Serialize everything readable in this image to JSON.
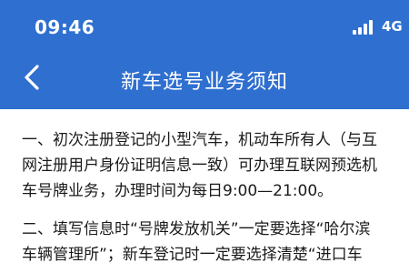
{
  "status_bar": {
    "time": "09:46",
    "network": "4G",
    "signal_icon": "signal-bars-icon"
  },
  "nav": {
    "title": "新车选号业务须知",
    "back_icon": "chevron-left-icon"
  },
  "colors": {
    "header_bg": "#2f6fd0",
    "header_text": "#ffffff",
    "body_text": "#1a1a1a"
  },
  "content": {
    "paragraphs": [
      {
        "lines": [
          "一、初次注册登记的小型汽车，机动车所有人（与互",
          "网注册用户身份证明信息一致）可办理互联网预选机",
          "车号牌业务，办理时间为每日9:00—21:00。"
        ]
      },
      {
        "lines": [
          "二、填写信息时“号牌发放机关”一定要选择“哈尔滨",
          "车辆管理所”；新车登记时一定要选择清楚“进口车"
        ]
      }
    ]
  }
}
